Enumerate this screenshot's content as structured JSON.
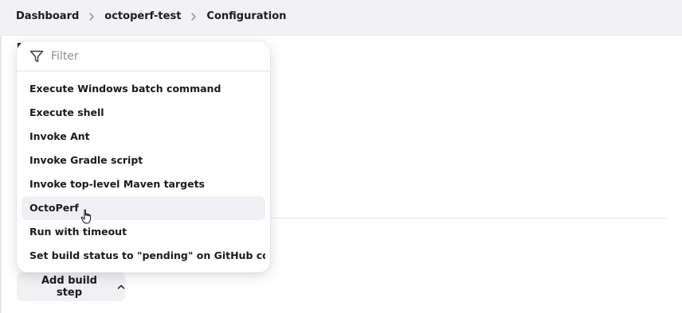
{
  "breadcrumb": {
    "items": [
      "Dashboard",
      "octoperf-test",
      "Configuration"
    ],
    "separator_icon": "chevron-right-icon"
  },
  "dropdown": {
    "filter_placeholder": "Filter",
    "filter_value": "",
    "filter_icon": "filter-funnel-icon",
    "items": [
      "Execute Windows batch command",
      "Execute shell",
      "Invoke Ant",
      "Invoke Gradle script",
      "Invoke top-level Maven targets",
      "OctoPerf",
      "Run with timeout",
      "Set build status to \"pending\" on GitHub commit"
    ],
    "hovered_item": "OctoPerf"
  },
  "add_build_step": {
    "label": "Add build step",
    "icon": "chevron-up-icon"
  },
  "colors": {
    "topbar_bg": "#f2f2f5",
    "hover_bg": "#f0f0f4",
    "button_bg": "#f1f1f4",
    "text": "#1a1a1f",
    "muted": "#8c8c94"
  }
}
